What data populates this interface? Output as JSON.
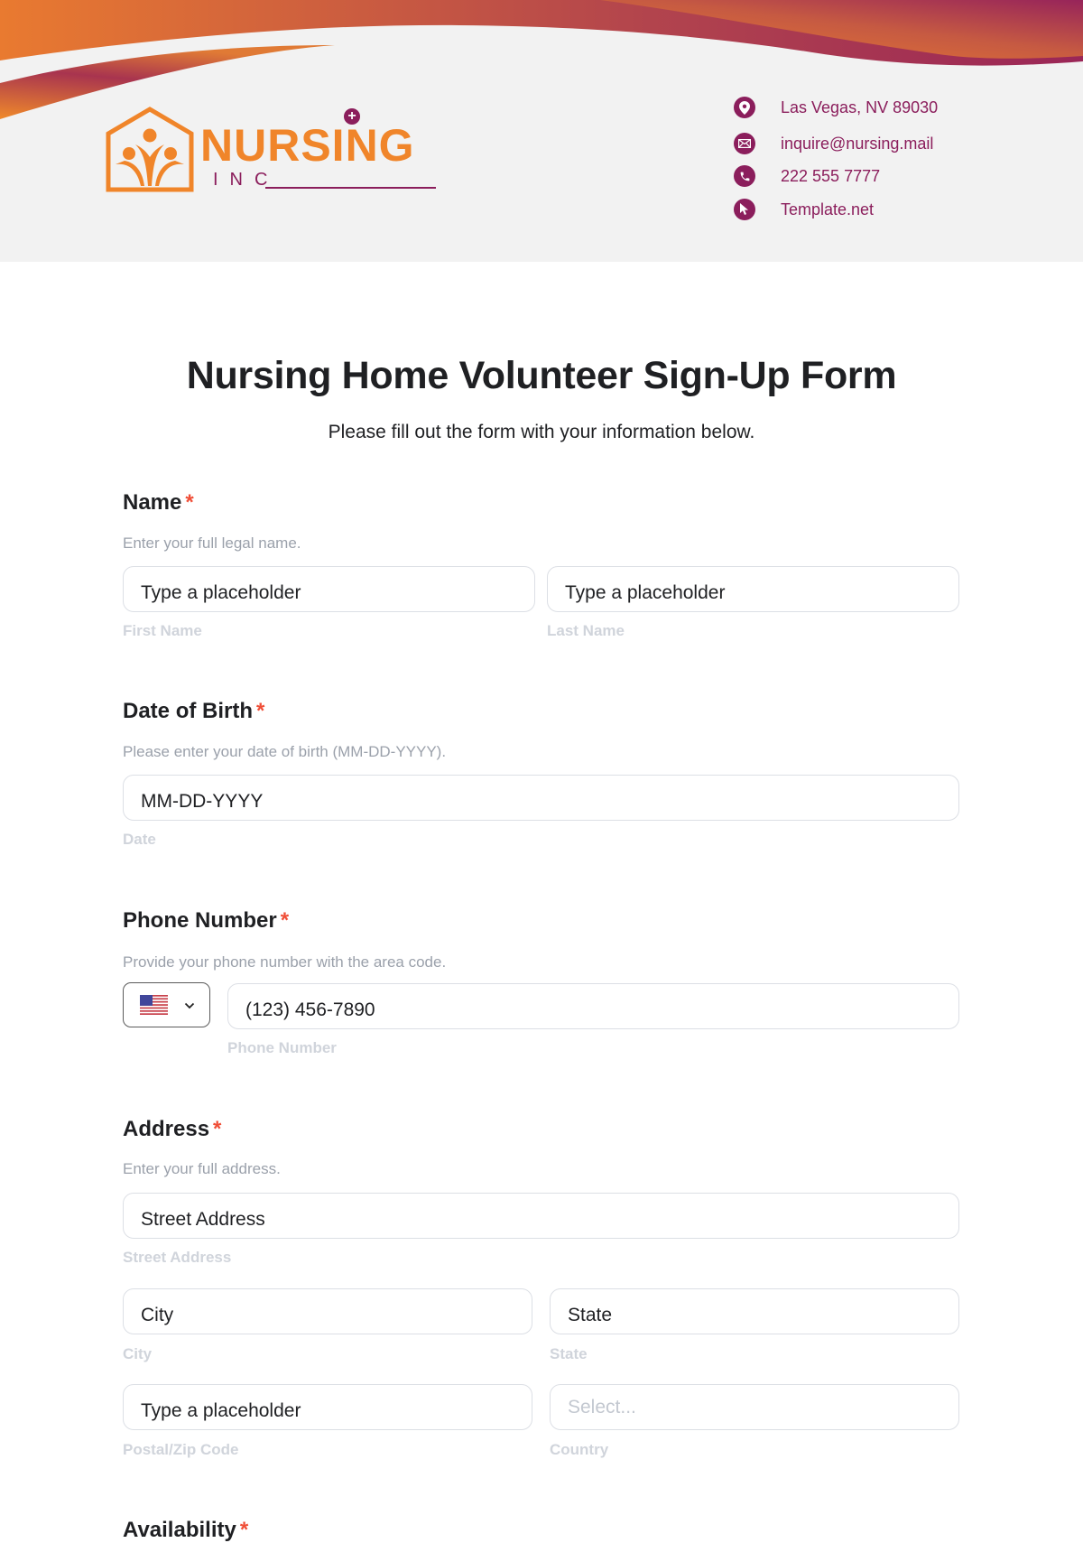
{
  "header": {
    "logo": {
      "word": "NURSING",
      "sub": "INC",
      "plus": "+"
    },
    "contacts": [
      {
        "icon": "location-pin-icon",
        "text": "Las Vegas, NV 89030"
      },
      {
        "icon": "envelope-icon",
        "text": "inquire@nursing.mail"
      },
      {
        "icon": "phone-icon",
        "text": "222 555 7777"
      },
      {
        "icon": "cursor-pointer-icon",
        "text": "Template.net"
      }
    ],
    "colors": {
      "orange": "#f0852a",
      "plum": "#8b1e5c",
      "band": "#f2f2f2"
    }
  },
  "form": {
    "title": "Nursing Home Volunteer Sign-Up Form",
    "subtitle": "Please fill out the form with your information below.",
    "required_mark": "*",
    "name": {
      "label": "Name",
      "helper": "Enter your full legal name.",
      "first": {
        "value": "Type a placeholder",
        "sublabel": "First Name"
      },
      "last": {
        "value": "Type a placeholder",
        "sublabel": "Last Name"
      }
    },
    "dob": {
      "label": "Date of Birth",
      "helper": "Please enter your date of birth (MM-DD-YYYY).",
      "value": "MM-DD-YYYY",
      "sublabel": "Date"
    },
    "phone": {
      "label": "Phone Number",
      "helper": "Provide your phone number with the area code.",
      "country_flag": "us-flag-icon",
      "value": "(123) 456-7890",
      "sublabel": "Phone Number"
    },
    "address": {
      "label": "Address",
      "helper": "Enter your full address.",
      "street": {
        "value": "Street Address",
        "sublabel": "Street Address"
      },
      "city": {
        "value": "City",
        "sublabel": "City"
      },
      "state": {
        "value": "State",
        "sublabel": "State"
      },
      "postal": {
        "value": "Type a placeholder",
        "sublabel": "Postal/Zip Code"
      },
      "country": {
        "placeholder": "Select...",
        "sublabel": "Country"
      }
    },
    "availability": {
      "label": "Availability"
    },
    "colors": {
      "required": "#f04e37",
      "helper": "#9ba1ab",
      "sublabel": "#d0d4db"
    }
  }
}
